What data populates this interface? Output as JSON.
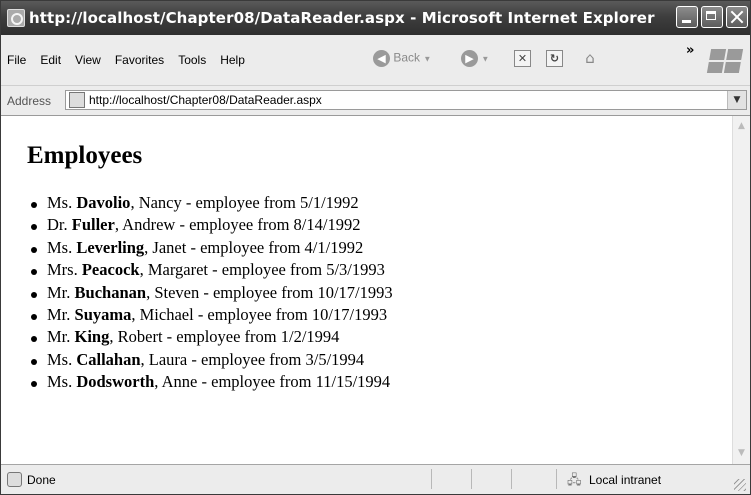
{
  "window": {
    "title": "http://localhost/Chapter08/DataReader.aspx - Microsoft Internet Explorer"
  },
  "menu": [
    "File",
    "Edit",
    "View",
    "Favorites",
    "Tools",
    "Help"
  ],
  "toolbar": {
    "back_label": "Back",
    "overflow": "»",
    "icons": [
      "back-icon",
      "forward-icon",
      "stop-icon",
      "refresh-icon",
      "home-icon",
      "windows-logo-icon"
    ]
  },
  "address": {
    "label": "Address",
    "url": "http://localhost/Chapter08/DataReader.aspx"
  },
  "page": {
    "heading": "Employees",
    "employees": [
      {
        "title": "Ms.",
        "last": "Davolio",
        "first": "Nancy",
        "date": "5/1/1992"
      },
      {
        "title": "Dr.",
        "last": "Fuller",
        "first": "Andrew",
        "date": "8/14/1992"
      },
      {
        "title": "Ms.",
        "last": "Leverling",
        "first": "Janet",
        "date": "4/1/1992"
      },
      {
        "title": "Mrs.",
        "last": "Peacock",
        "first": "Margaret",
        "date": "5/3/1993"
      },
      {
        "title": "Mr.",
        "last": "Buchanan",
        "first": "Steven",
        "date": "10/17/1993"
      },
      {
        "title": "Mr.",
        "last": "Suyama",
        "first": "Michael",
        "date": "10/17/1993"
      },
      {
        "title": "Mr.",
        "last": "King",
        "first": "Robert",
        "date": "1/2/1994"
      },
      {
        "title": "Ms.",
        "last": "Callahan",
        "first": "Laura",
        "date": "3/5/1994"
      },
      {
        "title": "Ms.",
        "last": "Dodsworth",
        "first": "Anne",
        "date": "11/15/1994"
      }
    ]
  },
  "status": {
    "text": "Done",
    "zone": "Local intranet"
  }
}
